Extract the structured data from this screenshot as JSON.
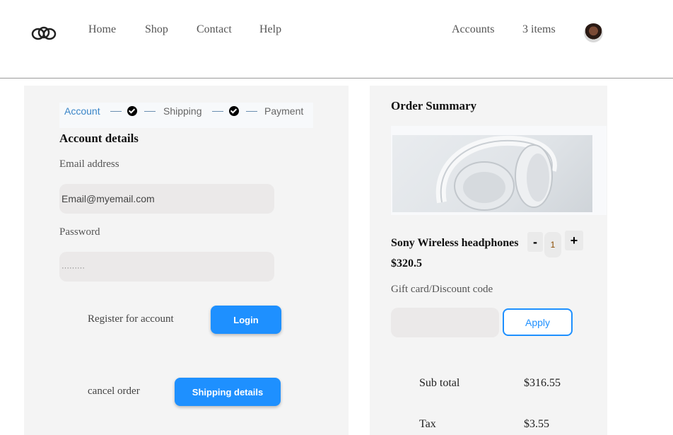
{
  "nav": {
    "home": "Home",
    "shop": "Shop",
    "contact": "Contact",
    "help": "Help"
  },
  "header_right": {
    "accounts": "Accounts",
    "cart_count": "3 items"
  },
  "stepper": {
    "step1": "Account",
    "step2": "Shipping",
    "step3": "Payment"
  },
  "account": {
    "title": "Account details",
    "email_label": "Email address",
    "email_value": "Email@myemail.com",
    "password_label": "Password",
    "password_value": "·········",
    "register_link": "Register for account",
    "login_button": "Login",
    "cancel_link": "cancel order",
    "shipping_button": "Shipping details"
  },
  "summary": {
    "title": "Order Summary",
    "product_name": "Sony Wireless headphones",
    "minus": "-",
    "plus": "+",
    "quantity": "1",
    "price": "$320.5",
    "discount_label": "Gift card/Discount code",
    "apply_button": "Apply",
    "subtotal_label": "Sub total",
    "subtotal_value": "$316.55",
    "tax_label": "Tax",
    "tax_value": "$3.55"
  },
  "colors": {
    "accent": "#1e90ff",
    "panel": "#f4f4f4",
    "input": "#ebe9e9"
  }
}
